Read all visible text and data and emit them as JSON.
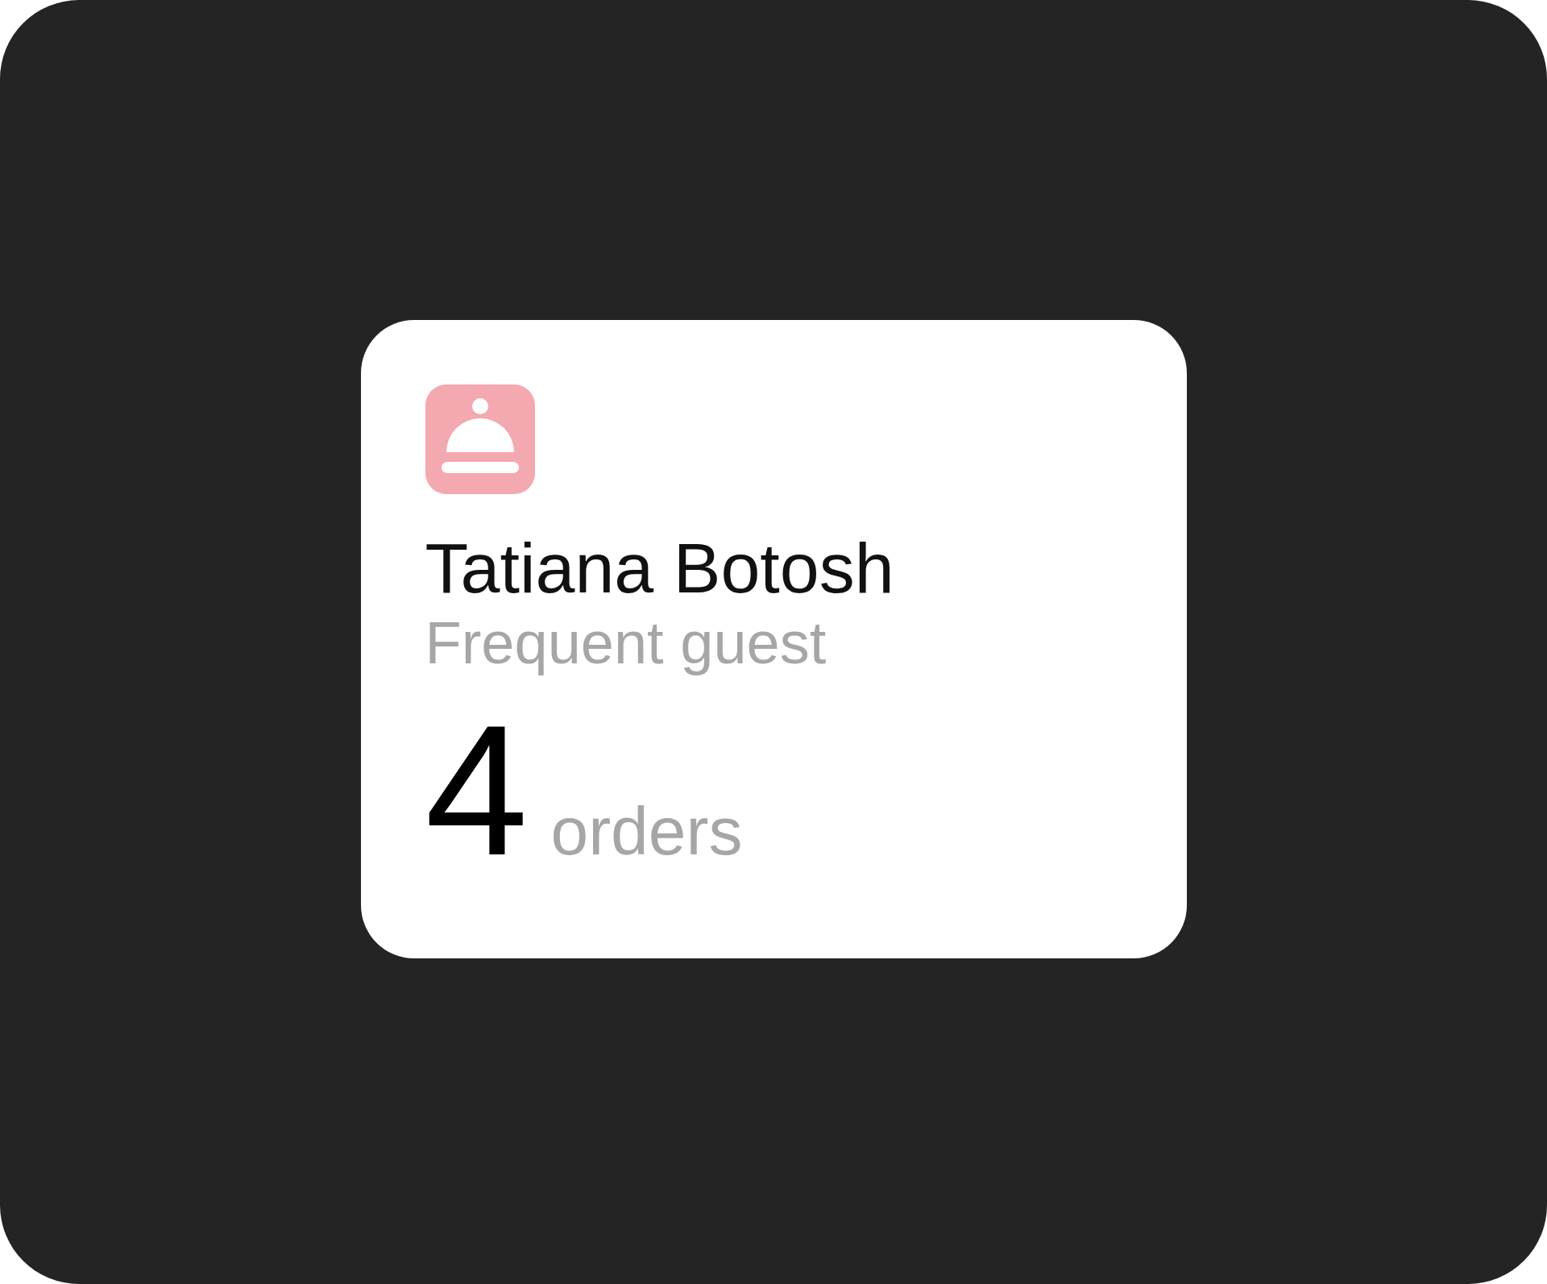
{
  "card": {
    "name": "Tatiana Botosh",
    "subtitle": "Frequent guest",
    "count": "4",
    "unit": "orders"
  }
}
